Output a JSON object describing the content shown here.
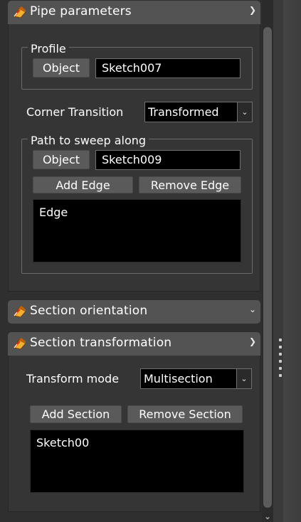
{
  "panels": {
    "pipe_parameters": {
      "title": "Pipe parameters",
      "profile": {
        "group_title": "Profile",
        "object_button": "Object",
        "object_value": "Sketch007"
      },
      "corner_transition": {
        "label": "Corner Transition",
        "value": "Transformed"
      },
      "path": {
        "group_title": "Path to sweep along",
        "object_button": "Object",
        "object_value": "Sketch009",
        "add_edge": "Add Edge",
        "remove_edge": "Remove Edge",
        "edges": [
          "Edge"
        ]
      }
    },
    "section_orientation": {
      "title": "Section orientation"
    },
    "section_transformation": {
      "title": "Section transformation",
      "transform_mode_label": "Transform mode",
      "transform_mode_value": "Multisection",
      "add_section": "Add Section",
      "remove_section": "Remove Section",
      "sections": [
        "Sketch00"
      ]
    }
  },
  "icons": {
    "panel": "pipe-sweep-icon",
    "expanded": "chevron-up-icon",
    "collapsed": "chevron-down-icon",
    "dropdown": "chevron-down-icon"
  },
  "colors": {
    "header_bg": "#535353",
    "body_bg": "#353535",
    "field_bg": "#000000",
    "button_bg": "#5a5a5a"
  }
}
